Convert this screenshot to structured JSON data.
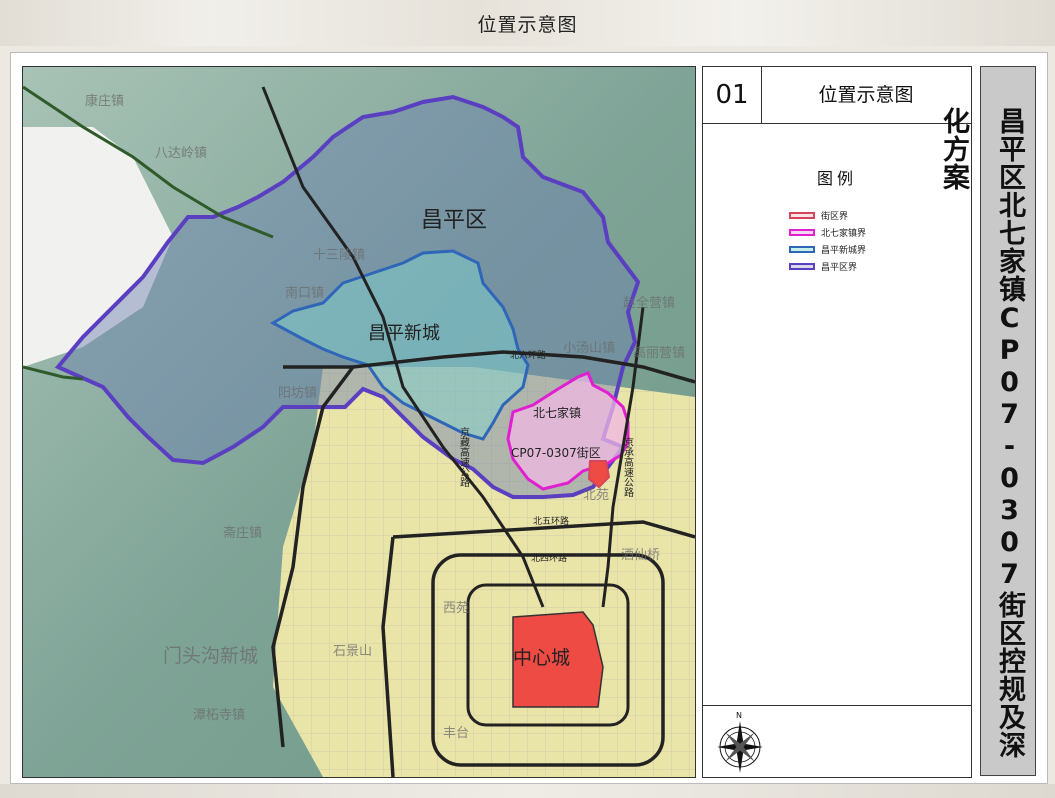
{
  "header": {
    "title": "位置示意图"
  },
  "sheet": {
    "number": "01",
    "title": "位置示意图"
  },
  "project_title": "昌平区北七家镇CP07-0307街区控规及深化方案",
  "legend": {
    "title": "图例",
    "items": [
      {
        "label": "街区界",
        "color": "#d2475c"
      },
      {
        "label": "北七家镇界",
        "color": "#e020d0"
      },
      {
        "label": "昌平新城界",
        "color": "#2f66b8"
      },
      {
        "label": "昌平区界",
        "color": "#5a3fc0"
      }
    ]
  },
  "compass": {
    "label": "N"
  },
  "map": {
    "district_label": "昌平区",
    "newtown_label": "昌平新城",
    "town_label": "北七家镇",
    "block_label": "CP07-0307街区",
    "center_label": "中心城",
    "roads": {
      "ring6": "北六环路",
      "ring5": "北五环路",
      "ring4": "北四环路",
      "jingzang": "京藏高速公路",
      "jingcheng": "京承高速公路"
    },
    "places": {
      "kangzhuang": "康庄镇",
      "badaling": "八达岭镇",
      "shisanling": "十三陵镇",
      "nankou": "南口镇",
      "zhaoquanying": "赵全营镇",
      "xiaotangshan": "小汤山镇",
      "gaoliying": "高丽营镇",
      "yangfang": "阳坊镇",
      "beiyuan": "北苑",
      "xiyuan": "西苑",
      "zhaitang": "斋庄镇",
      "mentougou": "门头沟新城",
      "shijingshan": "石景山",
      "tanzhesi": "潭柘寺镇",
      "fengtai": "丰台",
      "jiuxianqiao": "酒仙桥"
    },
    "colors": {
      "mountain": "#7fa497",
      "plain": "#e9e4a8",
      "center": "#ee4b44",
      "district": "#5a3fc0",
      "newtown": "#2f66b8",
      "town": "#e020d0",
      "block": "#d2475c"
    }
  }
}
